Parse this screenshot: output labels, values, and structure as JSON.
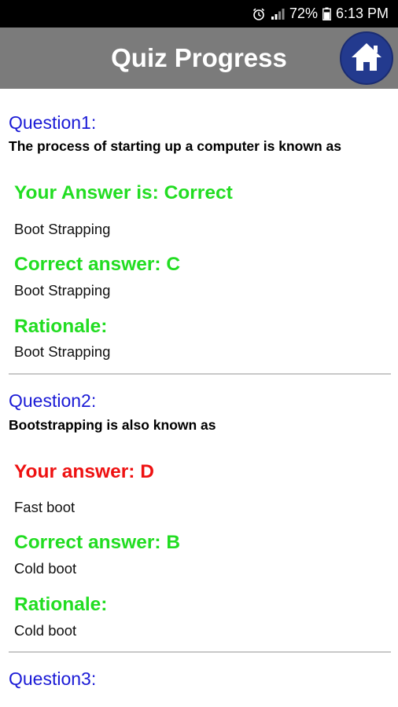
{
  "status_bar": {
    "battery": "72%",
    "time": "6:13 PM",
    "icons": [
      "alarm-icon",
      "signal-icon",
      "battery-icon"
    ]
  },
  "header": {
    "title": "Quiz Progress",
    "home_icon": "home-icon"
  },
  "questions": [
    {
      "label": "Question1:",
      "text": "The process of starting up a computer is known as",
      "your_answer_heading": "Your Answer is: Correct",
      "your_answer_text": "Boot Strapping",
      "correct_heading": "Correct answer: C",
      "correct_text": "Boot Strapping",
      "rationale_heading": "Rationale:",
      "rationale_text": "Boot Strapping"
    },
    {
      "label": "Question2:",
      "text": "Bootstrapping is also known as",
      "your_answer_heading": "Your answer: D",
      "your_answer_text": "Fast boot",
      "correct_heading": "Correct answer: B",
      "correct_text": "Cold boot",
      "rationale_heading": "Rationale:",
      "rationale_text": "Cold boot"
    },
    {
      "label": "Question3:"
    }
  ],
  "colors": {
    "status_bar": "#000000",
    "app_bar": "#7b7b7b",
    "home_button": "#233a8e",
    "question_label": "#1a1ad6",
    "correct": "#22dd22",
    "wrong": "#ee1111"
  }
}
